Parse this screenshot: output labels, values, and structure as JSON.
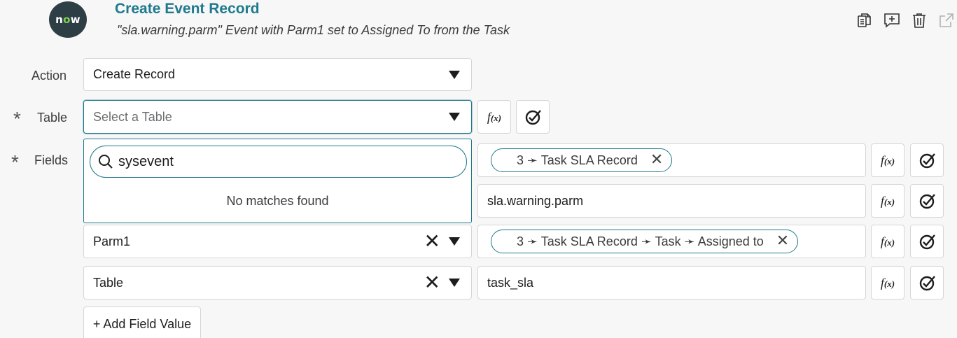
{
  "logo": {
    "text_n": "n",
    "text_o": "o",
    "text_w": "w"
  },
  "step": {
    "title": "Create Event Record",
    "description": "\"sla.warning.parm\" Event with Parm1 set to Assigned To from the Task"
  },
  "toolbar": {
    "icons": [
      "copy-icon",
      "add-comment-icon",
      "trash-icon",
      "external-link-icon"
    ]
  },
  "action": {
    "label": "Action",
    "value": "Create Record"
  },
  "table": {
    "label": "Table",
    "required_mark": "*",
    "placeholder": "Select a Table"
  },
  "fields": {
    "label": "Fields",
    "required_mark": "*"
  },
  "dropdown": {
    "search_value": "sysevent",
    "empty_message": "No matches found"
  },
  "field_rows": [
    {
      "name": "",
      "value_pill": "3 ➛ Task SLA Record"
    },
    {
      "name": "",
      "value_text": "sla.warning.parm"
    },
    {
      "name": "Parm1",
      "value_pill": "3 ➛ Task SLA Record ➛ Task ➛ Assigned to"
    },
    {
      "name": "Table",
      "value_text": "task_sla"
    }
  ],
  "fx_label": "f",
  "fx_sub": "(x)",
  "add_field_label": "+ Add Field Value",
  "colors": {
    "accent": "#1f7a8c",
    "logo_bg": "#2e3e45",
    "logo_green": "#7fd14f"
  }
}
